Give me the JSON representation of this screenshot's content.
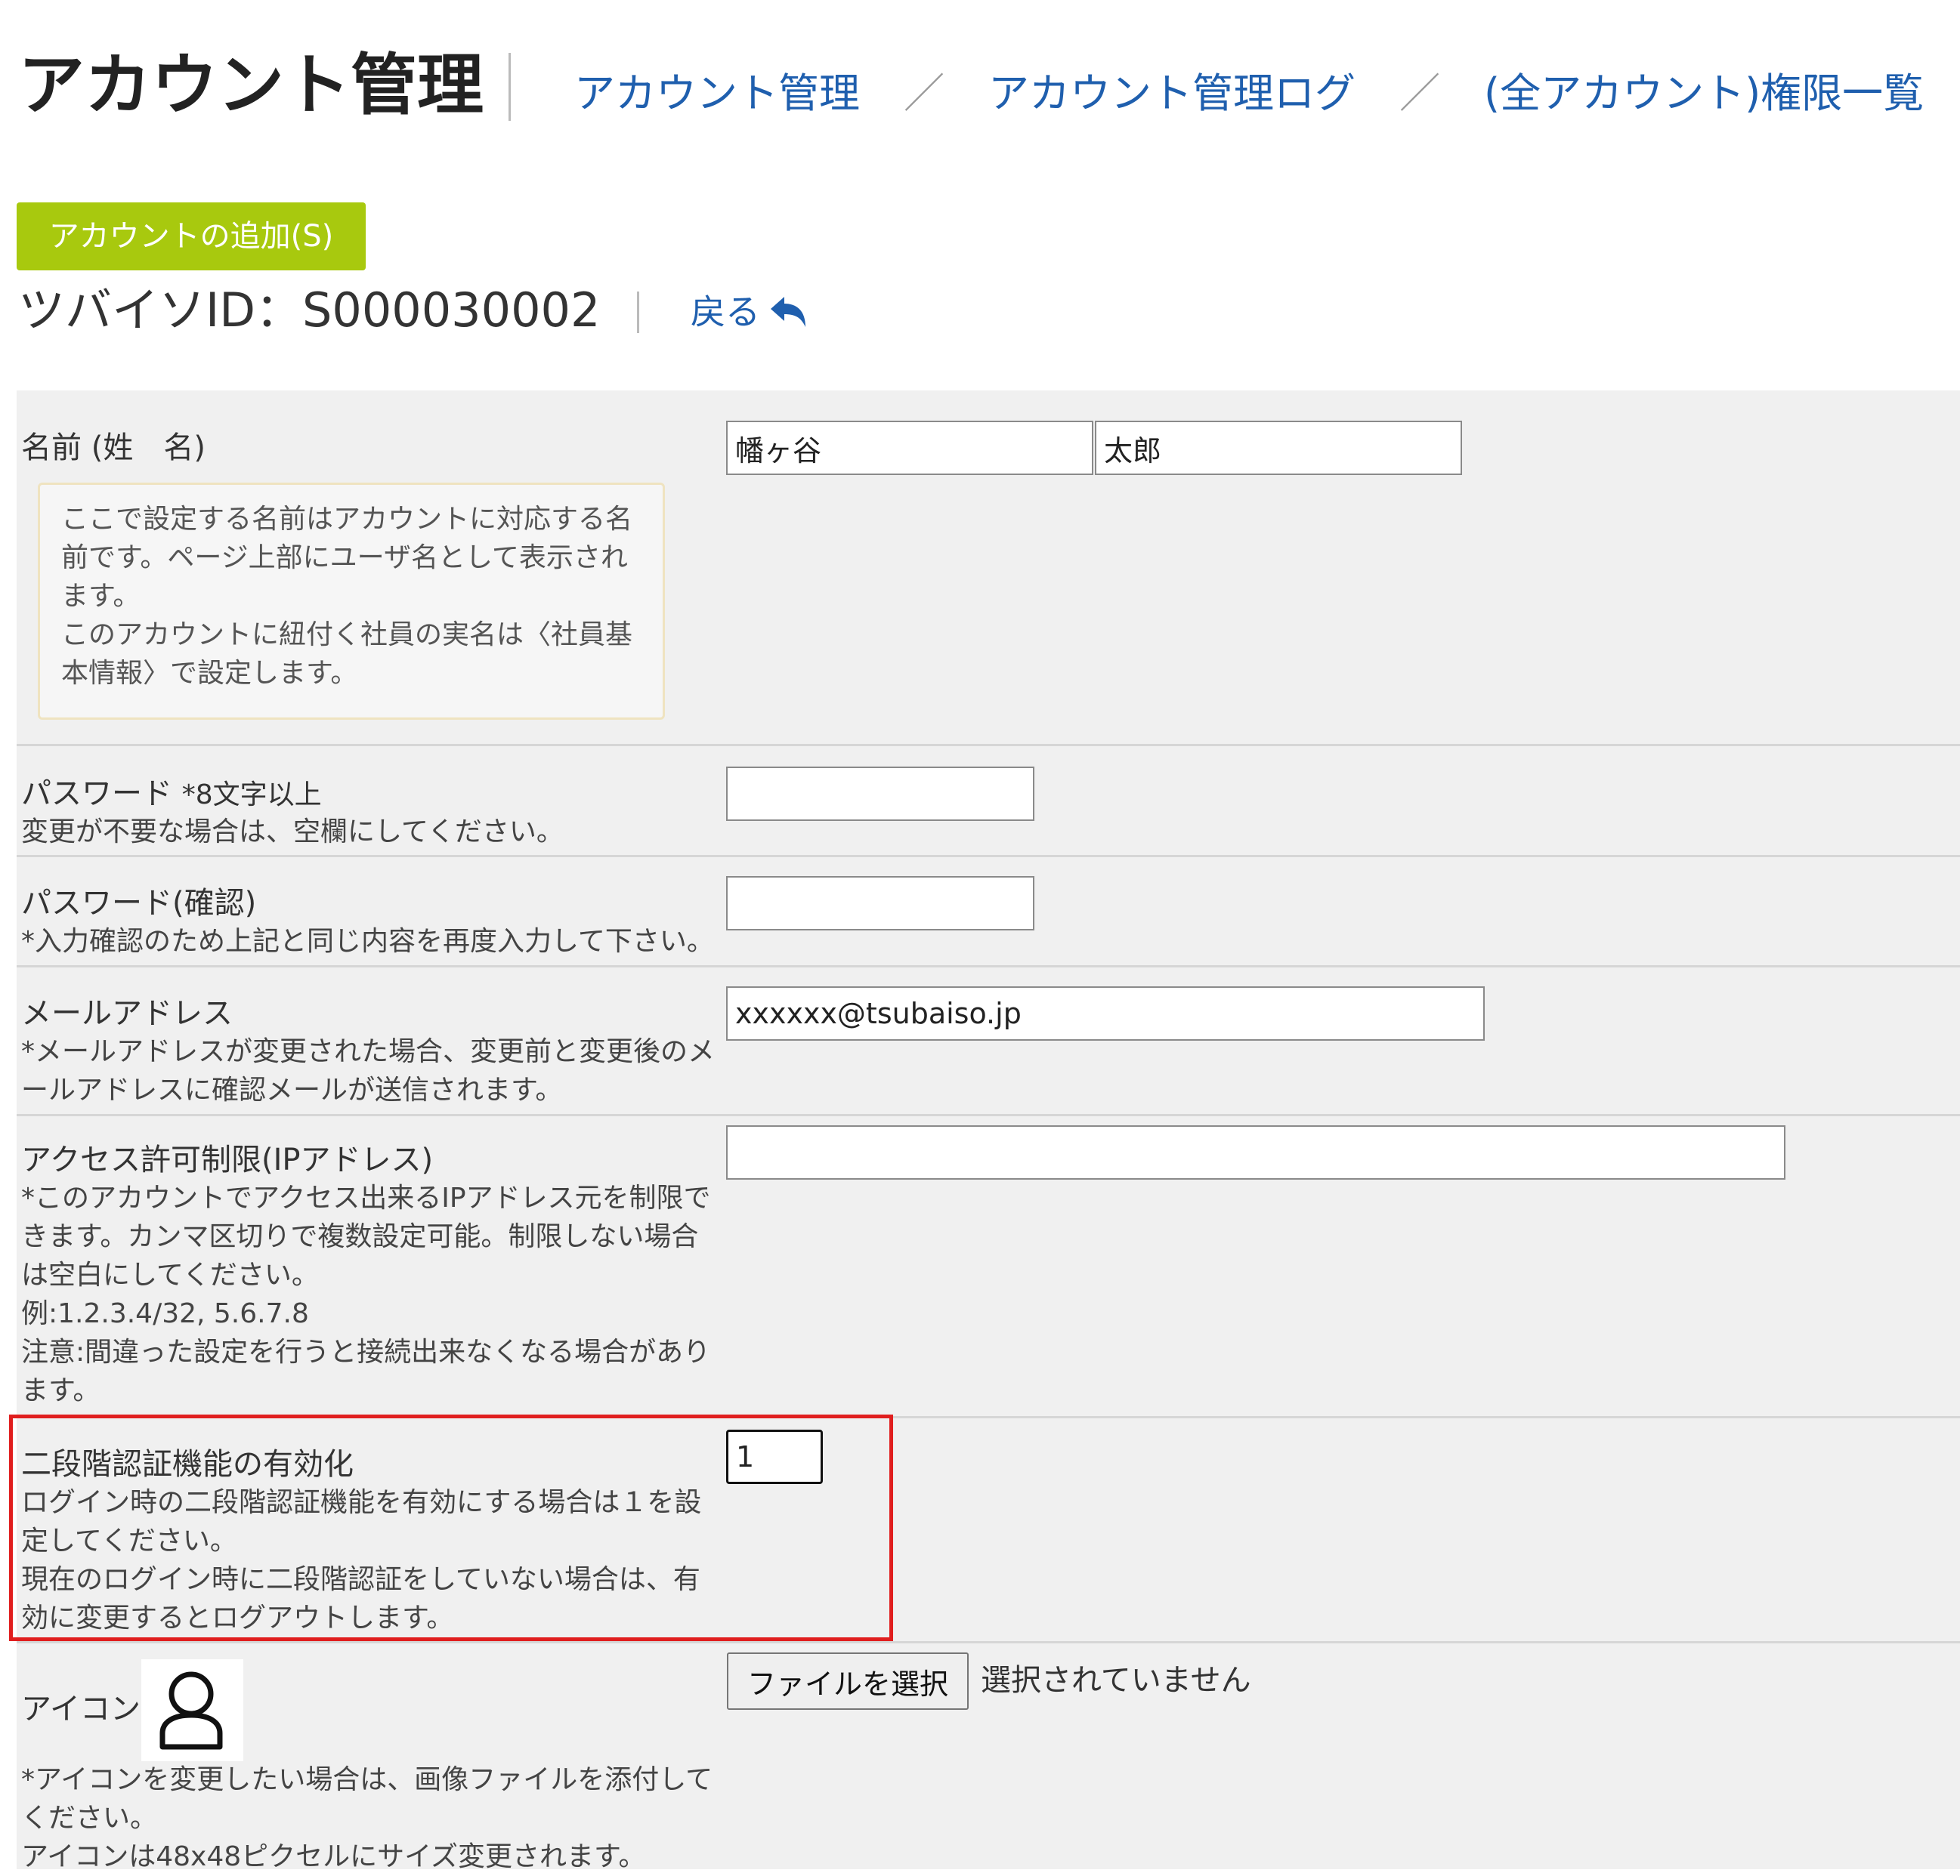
{
  "header": {
    "title": "アカウント管理",
    "breadcrumb": [
      {
        "label": "アカウント管理"
      },
      {
        "label": "アカウント管理ログ"
      },
      {
        "label": "(全アカウント)権限一覧"
      }
    ],
    "separator": "／"
  },
  "add_account_label": "アカウントの追加(S)",
  "account": {
    "id_label": "ツバイソID：",
    "id_value": "S000030002",
    "back_label": "戻る"
  },
  "form": {
    "name": {
      "label": "名前 (姓　名)",
      "info": [
        "ここで設定する名前はアカウントに対応する名",
        "前です。ページ上部にユーザ名として表示され",
        "ます。",
        "このアカウントに紐付く社員の実名は〈社員基",
        "本情報〉で設定します。"
      ],
      "last_name": "幡ヶ谷",
      "first_name": "太郎"
    },
    "password": {
      "label": "パスワード",
      "hint": "*8文字以上",
      "note": "変更が不要な場合は、空欄にしてください。",
      "value": ""
    },
    "password_confirm": {
      "label": "パスワード(確認)",
      "note": "*入力確認のため上記と同じ内容を再度入力して下さい。",
      "value": ""
    },
    "email": {
      "label": "メールアドレス",
      "note": [
        "*メールアドレスが変更された場合、変更前と変更後のメ",
        "ールアドレスに確認メールが送信されます。"
      ],
      "value": "xxxxxx@tsubaiso.jp"
    },
    "ip_restriction": {
      "label": "アクセス許可制限(IPアドレス)",
      "note": [
        "*このアカウントでアクセス出来るIPアドレス元を制限で",
        "きます。カンマ区切りで複数設定可能。制限しない場合",
        "は空白にしてください。",
        "例:1.2.3.4/32, 5.6.7.8",
        "注意:間違った設定を行うと接続出来なくなる場合があり",
        "ます。"
      ],
      "value": ""
    },
    "two_factor": {
      "label": "二段階認証機能の有効化",
      "note": [
        "ログイン時の二段階認証機能を有効にする場合は１を設",
        "定してください。",
        "現在のログイン時に二段階認証をしていない場合は、有",
        "効に変更するとログアウトします。"
      ],
      "value": "1"
    },
    "icon": {
      "label": "アイコン",
      "note": [
        "*アイコンを変更したい場合は、画像ファイルを添付して",
        "ください。",
        "アイコンは48x48ピクセルにサイズ変更されます。"
      ],
      "file_button_label": "ファイルを選択",
      "file_status": "選択されていません"
    }
  },
  "colors": {
    "link": "#1f5fae",
    "add_button": "#a8c90e",
    "highlight": "#e01e1e",
    "form_bg": "#f0f0f0"
  },
  "icons": {
    "back": "undo-arrow-icon",
    "avatar": "user-icon"
  }
}
